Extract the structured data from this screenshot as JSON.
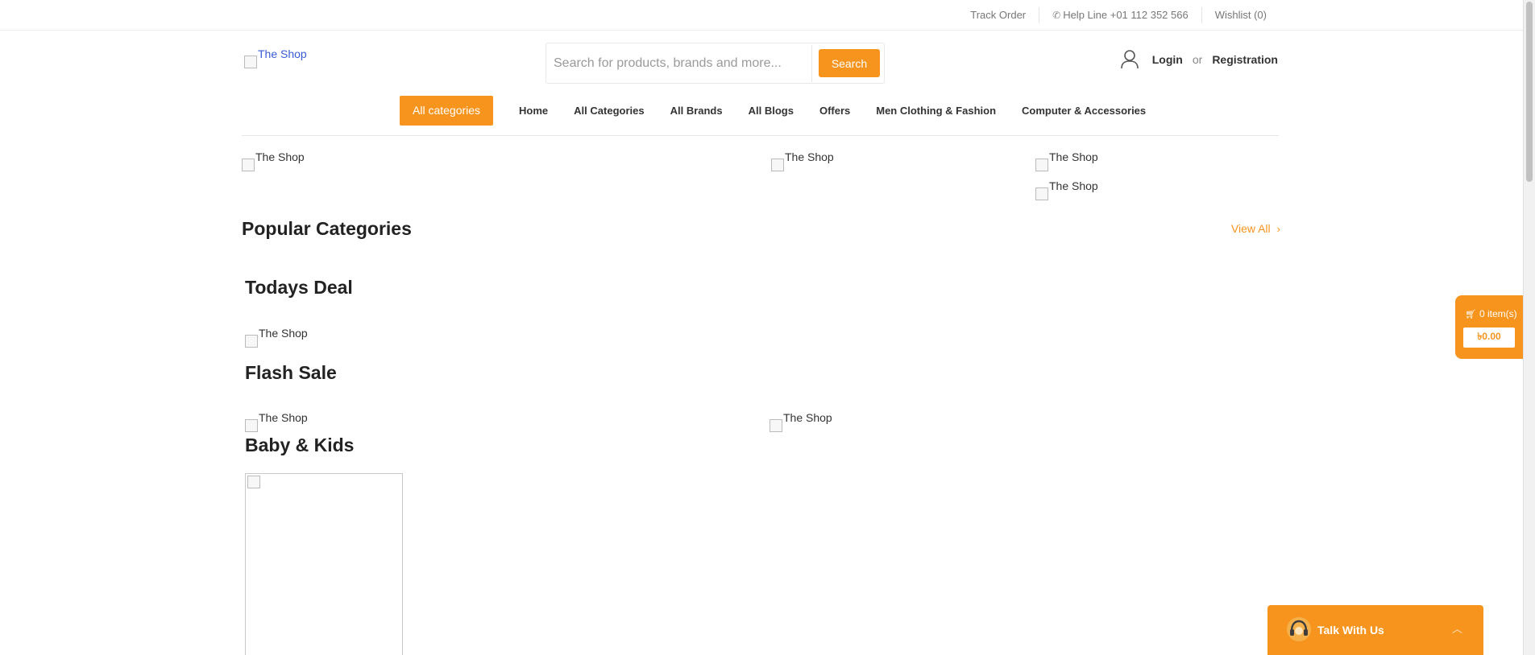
{
  "topbar": {
    "track_order": "Track Order",
    "help_line": "Help Line +01 112 352 566",
    "wishlist": "Wishlist (0)"
  },
  "header": {
    "logo_alt": "The Shop",
    "search": {
      "placeholder": "Search for products, brands and more...",
      "button": "Search"
    },
    "auth": {
      "login": "Login",
      "or": "or",
      "registration": "Registration"
    }
  },
  "nav": {
    "all_categories": "All categories",
    "items": [
      "Home",
      "All Categories",
      "All Brands",
      "All Blogs",
      "Offers",
      "Men Clothing & Fashion",
      "Computer & Accessories"
    ]
  },
  "banners": {
    "alt": "The Shop"
  },
  "sections": {
    "popular_categories": "Popular Categories",
    "view_all": "View All",
    "todays_deal": "Todays Deal",
    "flash_sale": "Flash Sale",
    "baby_kids": "Baby & Kids"
  },
  "cart": {
    "items": "0 item(s)",
    "amount": "৳0.00"
  },
  "chat": {
    "label": "Talk With Us"
  },
  "colors": {
    "accent": "#f7941d"
  }
}
